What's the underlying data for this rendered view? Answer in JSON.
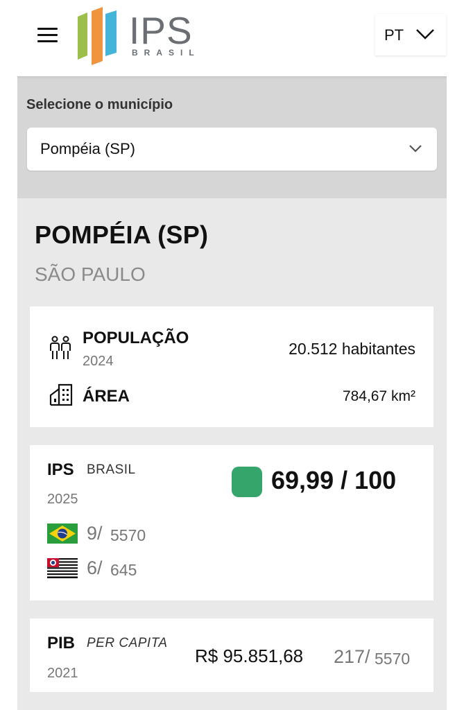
{
  "header": {
    "logo_text": "IPS",
    "logo_subtext": "BRASIL",
    "language": "PT",
    "colors": {
      "logo_green": "#9bbf4a",
      "logo_orange": "#f0953f",
      "logo_blue": "#45b4d9",
      "logo_gray": "#6b6f73"
    }
  },
  "selector": {
    "label": "Selecione o município",
    "value": "Pompéia (SP)"
  },
  "municipality": {
    "name": "POMPÉIA (SP)",
    "state": "SÃO PAULO"
  },
  "population": {
    "label": "POPULAÇÃO",
    "year": "2024",
    "value": "20.512 habitantes"
  },
  "area": {
    "label": "ÁREA",
    "value": "784,67 km²"
  },
  "ips": {
    "label": "IPS",
    "sub": "BRASIL",
    "year": "2025",
    "score": "69,99 / 100",
    "score_color": "#36a56b",
    "rank_brazil": {
      "rank": "9/",
      "total": "5570"
    },
    "rank_state": {
      "rank": "6/",
      "total": "645"
    }
  },
  "pib": {
    "label": "PIB",
    "sub": "PER CAPITA",
    "year": "2021",
    "value": "R$ 95.851,68",
    "rank": "217/",
    "total": "5570"
  }
}
